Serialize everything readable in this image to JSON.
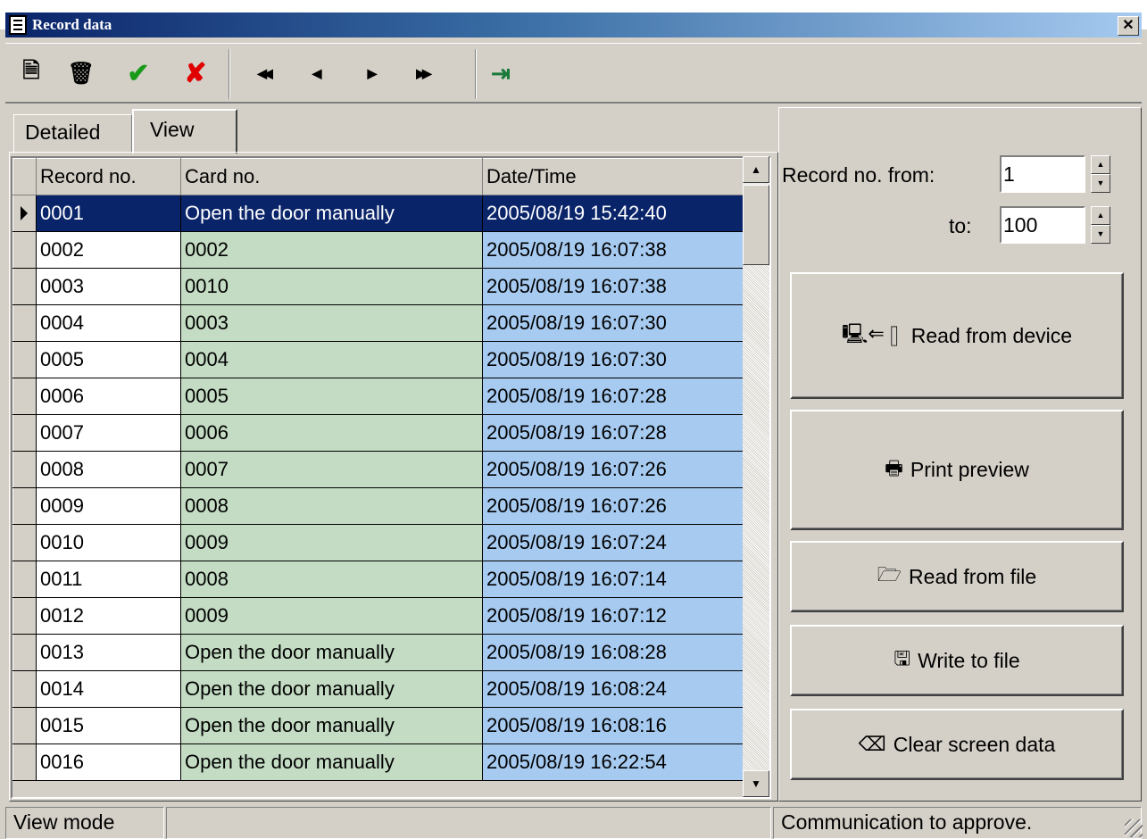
{
  "window": {
    "title": "Record data",
    "close_label": "✕"
  },
  "toolbar": {
    "buttons": [
      {
        "icon": "edit-record-icon",
        "glyph": "🗎"
      },
      {
        "icon": "trash-icon",
        "glyph": "🗑"
      },
      {
        "icon": "checkmark-icon",
        "glyph": "✔",
        "color": "#1a9a1a"
      },
      {
        "icon": "cross-icon",
        "glyph": "✘",
        "color": "#e00000"
      },
      {
        "icon": "first-record-icon",
        "glyph": "◀◀"
      },
      {
        "icon": "prev-record-icon",
        "glyph": "◀"
      },
      {
        "icon": "next-record-icon",
        "glyph": "▶"
      },
      {
        "icon": "last-record-icon",
        "glyph": "▶▶"
      },
      {
        "icon": "exit-icon",
        "glyph": "⇥"
      }
    ]
  },
  "tabs": {
    "detailed": "Detailed",
    "view": "View"
  },
  "grid": {
    "columns": [
      "Record no.",
      "Card no.",
      "Date/Time"
    ],
    "rows": [
      [
        "0001",
        "Open the door manually",
        "2005/08/19 15:42:40"
      ],
      [
        "0002",
        "0002",
        "2005/08/19 16:07:38"
      ],
      [
        "0003",
        "0010",
        "2005/08/19 16:07:38"
      ],
      [
        "0004",
        "0003",
        "2005/08/19 16:07:30"
      ],
      [
        "0005",
        "0004",
        "2005/08/19 16:07:30"
      ],
      [
        "0006",
        "0005",
        "2005/08/19 16:07:28"
      ],
      [
        "0007",
        "0006",
        "2005/08/19 16:07:28"
      ],
      [
        "0008",
        "0007",
        "2005/08/19 16:07:26"
      ],
      [
        "0009",
        "0008",
        "2005/08/19 16:07:26"
      ],
      [
        "0010",
        "0009",
        "2005/08/19 16:07:24"
      ],
      [
        "0011",
        "0008",
        "2005/08/19 16:07:14"
      ],
      [
        "0012",
        "0009",
        "2005/08/19 16:07:12"
      ],
      [
        "0013",
        "Open the door manually",
        "2005/08/19 16:08:28"
      ],
      [
        "0014",
        "Open the door manually",
        "2005/08/19 16:08:24"
      ],
      [
        "0015",
        "Open the door manually",
        "2005/08/19 16:08:16"
      ],
      [
        "0016",
        "Open the door manually",
        "2005/08/19 16:22:54"
      ]
    ],
    "selected_row": 0
  },
  "range": {
    "from_label": "Record no. from:",
    "from_value": "1",
    "to_label": "to:",
    "to_value": "100"
  },
  "buttons": {
    "read_device": "Read from device",
    "print_preview": "Print preview",
    "read_file": "Read from file",
    "write_file": "Write to file",
    "clear_screen": "Clear screen data"
  },
  "status": {
    "mode": "View mode",
    "middle": "",
    "message": "Communication to approve."
  }
}
